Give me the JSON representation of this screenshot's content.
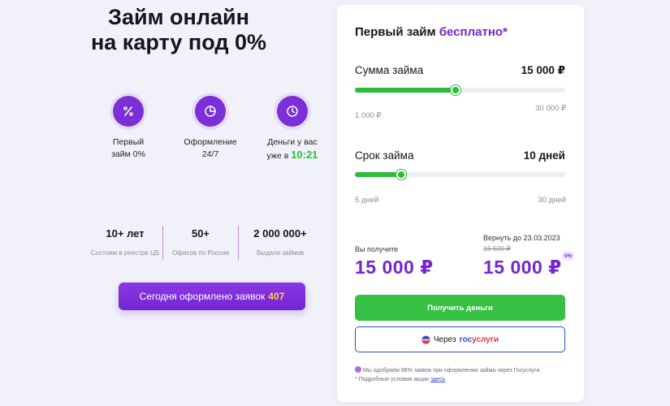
{
  "hero": {
    "title_line1": "Займ онлайн",
    "title_line2": "на карту под 0%"
  },
  "features": [
    {
      "icon": "percent-icon",
      "line1": "Первый",
      "line2": "займ 0%"
    },
    {
      "icon": "pie-chart-icon",
      "line1": "Оформление",
      "line2": "24/7"
    },
    {
      "icon": "clock-icon",
      "line1": "Деньги у вас",
      "line2_prefix": "уже в",
      "time": "10:21"
    }
  ],
  "stats": [
    {
      "value": "10+ лет",
      "caption": "Состоим в реестре ЦБ"
    },
    {
      "value": "50+",
      "caption": "Офисов по России"
    },
    {
      "value": "2 000 000+",
      "caption": "Выдали займов"
    }
  ],
  "cta_left": {
    "label": "Сегодня оформлено заявок",
    "count": "407"
  },
  "card": {
    "title_prefix": "Первый займ",
    "title_accent": "бесплатно*",
    "amount": {
      "label": "Сумма займа",
      "value": "15 000 ₽",
      "min": "1 000 ₽",
      "max": "30 000 ₽",
      "slider_fraction": 0.48
    },
    "term": {
      "label": "Срок займа",
      "value": "10 дней",
      "min": "5 дней",
      "max": "30 дней",
      "slider_fraction": 0.22
    },
    "receive_label": "Вы получите",
    "receive_value": "15 000 ₽",
    "return_label": "Вернуть до 23.03.2023",
    "return_old": "16 500 ₽",
    "return_value": "15 000 ₽",
    "zero_badge": "0%",
    "get_money_button": "Получить деньги",
    "gosuslugi_button": {
      "prefix": "Через",
      "brand_part1": "гос",
      "brand_part2": "услуги"
    },
    "note1": "Мы одобряем 98% заявок при оформлении займа через Госуслуги",
    "note2_prefix": "* Подробные условия акции",
    "note2_link": "здесь"
  },
  "colors": {
    "accent_purple": "#7326cf",
    "accent_green": "#2dbb3a",
    "gosuslugi_blue": "#2d4cc9",
    "gosuslugi_red": "#e7344a",
    "badge_yellow": "#ffd530"
  }
}
